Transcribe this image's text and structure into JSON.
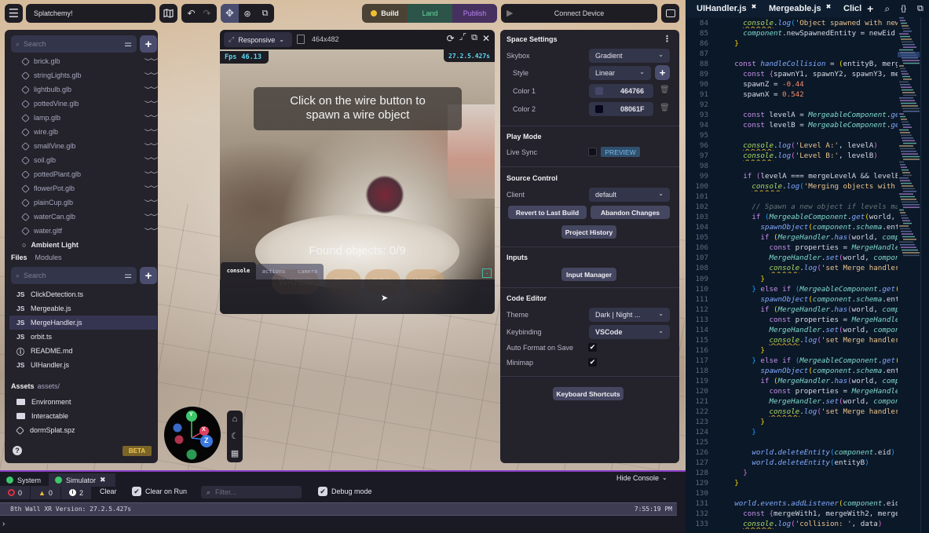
{
  "topbar": {
    "project_name": "Splatchemy!",
    "map_icon": "map-icon",
    "undo_icon": "undo-icon",
    "redo_icon": "redo-icon",
    "tools": [
      "move-icon",
      "orbit-icon",
      "scale-icon"
    ],
    "build_label": "Build",
    "build_status_color": "#f0c030",
    "land_label": "Land",
    "publish_label": "Publish",
    "connect_device_label": "Connect Device"
  },
  "hierarchy": {
    "search_placeholder": "Search",
    "items": [
      {
        "label": "brick.glb"
      },
      {
        "label": "stringLights.glb"
      },
      {
        "label": "lightbulb.glb"
      },
      {
        "label": "pottedVine.glb"
      },
      {
        "label": "lamp.glb"
      },
      {
        "label": "wire.glb"
      },
      {
        "label": "smallVine.glb"
      },
      {
        "label": "soil.glb"
      },
      {
        "label": "pottedPlant.glb"
      },
      {
        "label": "flowerPot.glb"
      },
      {
        "label": "plainCup.glb"
      },
      {
        "label": "waterCan.glb"
      },
      {
        "label": "water.gltf"
      }
    ],
    "partial_item": "Ambient Light"
  },
  "files": {
    "tabs": [
      "Files",
      "Modules"
    ],
    "search_placeholder": "Search",
    "items": [
      {
        "type": "JS",
        "label": "ClickDetection.ts",
        "active": false
      },
      {
        "type": "JS",
        "label": "Mergeable.js",
        "active": false
      },
      {
        "type": "JS",
        "label": "MergeHandler.js",
        "active": true
      },
      {
        "type": "JS",
        "label": "orbit.ts",
        "active": false
      },
      {
        "type": "info",
        "label": "README.md",
        "active": false
      },
      {
        "type": "JS",
        "label": "UIHandler.js",
        "active": false
      }
    ],
    "assets_label": "Assets",
    "assets_path": "assets/",
    "assets": [
      {
        "type": "folder",
        "label": "Environment"
      },
      {
        "type": "folder",
        "label": "Interactable"
      },
      {
        "type": "model",
        "label": "dormSplat.spz"
      }
    ],
    "beta_label": "BETA"
  },
  "simulator": {
    "mode_label": "Responsive",
    "resolution": "464x482",
    "fps_label": "Fps",
    "fps_value": "46.13",
    "version": "27.2.5.427s",
    "hint_line1": "Click on the wire button to",
    "hint_line2": "spawn a wire object",
    "found_text": "Found objects: 0/9",
    "object_buttons": [
      "WATER",
      "CUP",
      "SOIL",
      "WIRE"
    ],
    "console_tabs": [
      "console",
      "actions",
      "camera"
    ],
    "collapse_label": "-"
  },
  "gizmo": {
    "axes": [
      "Y",
      "X",
      "Z"
    ],
    "view_buttons": [
      "home-icon",
      "moon-icon",
      "globe-icon"
    ]
  },
  "settings": {
    "space_settings": {
      "title": "Space Settings",
      "skybox_label": "Skybox",
      "skybox_value": "Gradient",
      "style_label": "Style",
      "style_value": "Linear",
      "color1_label": "Color 1",
      "color1_value": "464766",
      "color1_swatch": "#464766",
      "color2_label": "Color 2",
      "color2_value": "08061F",
      "color2_swatch": "#08061F"
    },
    "play_mode": {
      "title": "Play Mode",
      "live_sync_label": "Live Sync",
      "preview_label": "PREVIEW",
      "live_sync_checked": false
    },
    "source_control": {
      "title": "Source Control",
      "client_label": "Client",
      "client_value": "default",
      "revert_label": "Revert to Last Build",
      "abandon_label": "Abandon Changes",
      "history_label": "Project History"
    },
    "inputs": {
      "title": "Inputs",
      "manager_label": "Input Manager"
    },
    "code_editor": {
      "title": "Code Editor",
      "theme_label": "Theme",
      "theme_value": "Dark | Night ...",
      "keybinding_label": "Keybinding",
      "keybinding_value": "VSCode",
      "autoformat_label": "Auto Format on Save",
      "autoformat_checked": true,
      "minimap_label": "Minimap",
      "minimap_checked": true,
      "shortcuts_label": "Keyboard Shortcuts"
    }
  },
  "editor": {
    "tabs": [
      "UIHandler.js",
      "Mergeable.js",
      "Clicl"
    ],
    "first_line": 84
  },
  "console": {
    "tabs": [
      "System",
      "Simulator"
    ],
    "hide_label": "Hide Console",
    "error_count": "0",
    "warning_count": "0",
    "info_count": "2",
    "clear_label": "Clear",
    "clear_on_run_label": "Clear on Run",
    "clear_on_run_checked": true,
    "filter_placeholder": "Filter...",
    "debug_label": "Debug mode",
    "debug_checked": true,
    "log_message": "8th Wall XR Version: 27.2.5.427s",
    "log_time": "7:55:19 PM",
    "prompt": "›"
  }
}
